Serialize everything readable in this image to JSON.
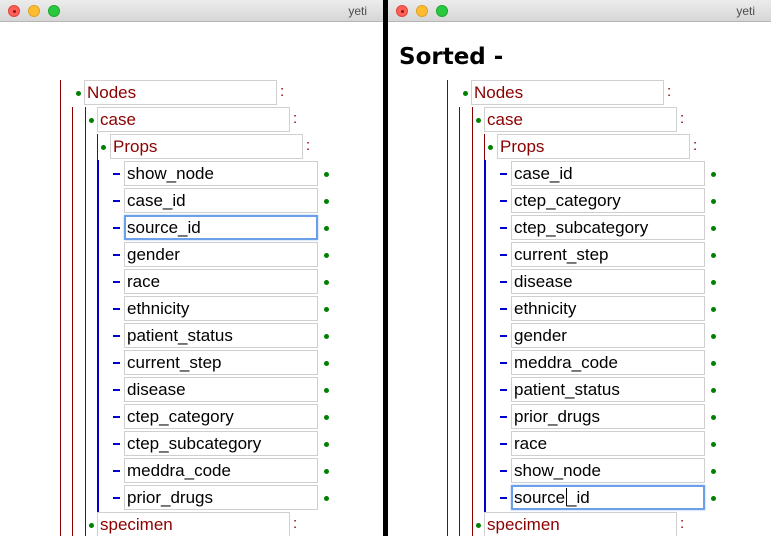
{
  "left_window": {
    "title": "yeti",
    "nodes_label": "Nodes",
    "case_label": "case",
    "props_label": "Props",
    "specimen_label": "specimen",
    "colon": ":",
    "props": [
      "show_node",
      "case_id",
      "source_id",
      "gender",
      "race",
      "ethnicity",
      "patient_status",
      "current_step",
      "disease",
      "ctep_category",
      "ctep_subcategory",
      "meddra_code",
      "prior_drugs"
    ],
    "focused_prop": "source_id"
  },
  "right_window": {
    "title": "yeti",
    "heading": "Sorted -",
    "nodes_label": "Nodes",
    "case_label": "case",
    "props_label": "Props",
    "specimen_label": "specimen",
    "colon": ":",
    "props": [
      "case_id",
      "ctep_category",
      "ctep_subcategory",
      "current_step",
      "disease",
      "ethnicity",
      "gender",
      "meddra_code",
      "patient_status",
      "prior_drugs",
      "race",
      "show_node",
      "source_id"
    ],
    "focused_prop": "source_id",
    "focused_value_before_caret": "source",
    "focused_value_after_caret": "_id"
  },
  "colors": {
    "node_text": "#8b0000",
    "bullet": "#008000",
    "prop_line": "#0000cc",
    "focus_ring": "#6b9fe8"
  }
}
